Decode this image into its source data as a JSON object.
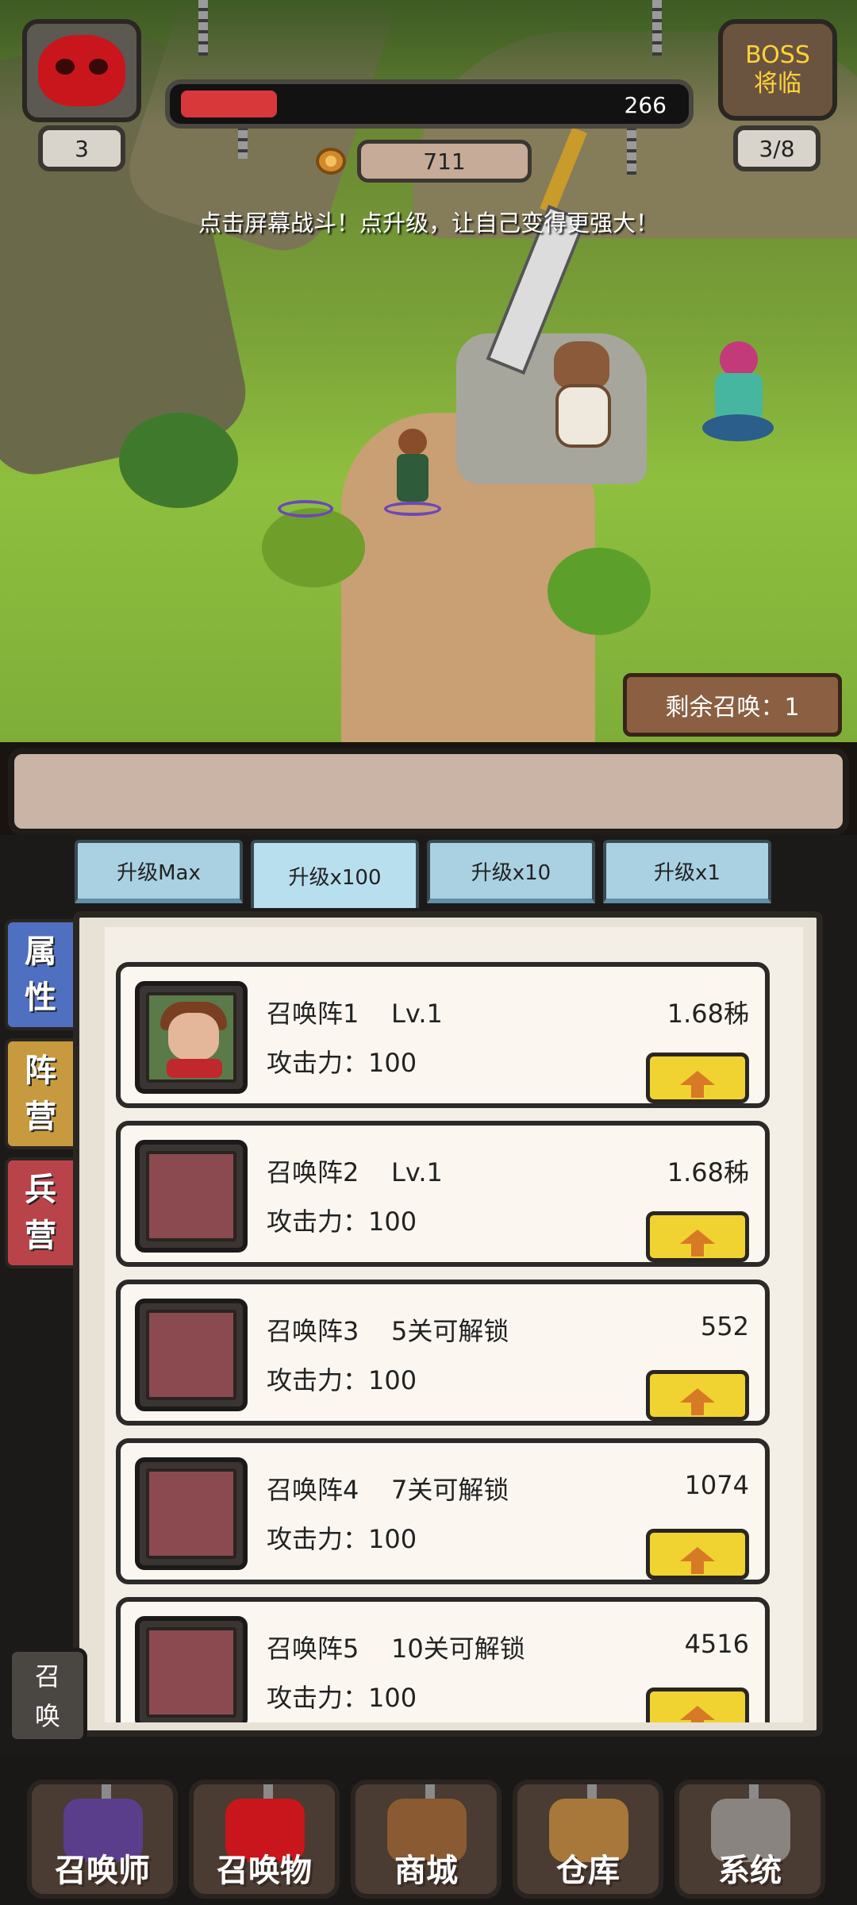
{
  "hud": {
    "level": "3",
    "hp_value": "266",
    "hp_ratio": 0.19,
    "coins": "711",
    "boss_line1": "BOSS",
    "boss_line2": "将临",
    "stage_progress": "3/8",
    "hint": "点击屏幕战斗！点升级，让自己变得更强大！",
    "summon_remaining": "剩余召唤：1"
  },
  "tabs": [
    {
      "label": "升级Max"
    },
    {
      "label": "升级x100",
      "active": true
    },
    {
      "label": "升级x10"
    },
    {
      "label": "升级x1"
    }
  ],
  "side_tabs": [
    {
      "line1": "属",
      "line2": "性"
    },
    {
      "line1": "阵",
      "line2": "营"
    },
    {
      "line1": "兵",
      "line2": "营"
    }
  ],
  "summon_side": {
    "line1": "召",
    "line2": "唤"
  },
  "cards": [
    {
      "title": "召唤阵1    Lv.1",
      "attack": "攻击力：100",
      "cost": "1.68秭"
    },
    {
      "title": "召唤阵2    Lv.1",
      "attack": "攻击力：100",
      "cost": "1.68秭"
    },
    {
      "title": "召唤阵3    5关可解锁",
      "attack": "攻击力：100",
      "cost": "552"
    },
    {
      "title": "召唤阵4    7关可解锁",
      "attack": "攻击力：100",
      "cost": "1074"
    },
    {
      "title": "召唤阵5    10关可解锁",
      "attack": "攻击力：100",
      "cost": "4516"
    }
  ],
  "nav": [
    {
      "label": "召唤师",
      "icon": "summoner-hat-icon"
    },
    {
      "label": "召唤物",
      "icon": "skull-icon"
    },
    {
      "label": "商城",
      "icon": "treasure-chest-icon"
    },
    {
      "label": "仓库",
      "icon": "backpack-icon"
    },
    {
      "label": "系统",
      "icon": "gear-icon"
    }
  ],
  "colors": {
    "hp": "#d9383b",
    "boss_text": "#ffd23a",
    "upgrade_button": "#f0d330",
    "tab": "#a9d1e2"
  }
}
